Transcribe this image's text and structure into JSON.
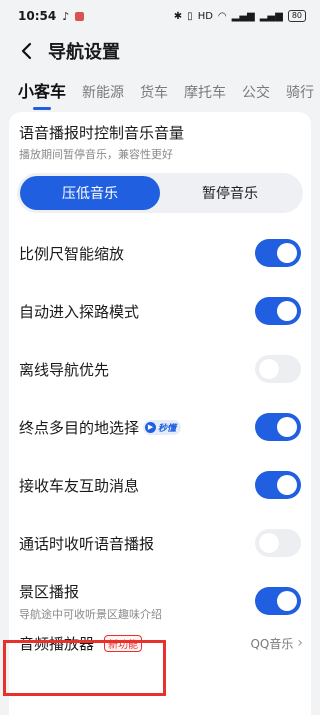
{
  "status_bar": {
    "time": "10:54",
    "battery": "80"
  },
  "nav": {
    "title": "导航设置"
  },
  "tabs": [
    {
      "label": "小客车",
      "active": true
    },
    {
      "label": "新能源",
      "active": false
    },
    {
      "label": "货车",
      "active": false
    },
    {
      "label": "摩托车",
      "active": false
    },
    {
      "label": "公交",
      "active": false
    },
    {
      "label": "骑行",
      "active": false
    }
  ],
  "music_control": {
    "title": "语音播报时控制音乐音量",
    "subtitle": "播放期间暂停音乐，兼容性更好",
    "options": [
      "压低音乐",
      "暂停音乐"
    ],
    "selected": "压低音乐"
  },
  "settings": [
    {
      "label": "比例尺智能缩放",
      "on": true
    },
    {
      "label": "自动进入探路模式",
      "on": true
    },
    {
      "label": "离线导航优先",
      "on": false
    },
    {
      "label": "终点多目的地选择",
      "badge": "秒懂",
      "on": true
    },
    {
      "label": "接收车友互助消息",
      "on": true
    },
    {
      "label": "通话时收听语音播报",
      "on": false
    }
  ],
  "scenic": {
    "label": "景区播报",
    "subtitle": "导航途中可收听景区趣味介绍",
    "on": true
  },
  "audio_player": {
    "label": "音频播放器",
    "badge": "新功能",
    "value": "QQ音乐"
  },
  "colors": {
    "accent": "#1f5fe0",
    "highlight": "#e8312d"
  }
}
